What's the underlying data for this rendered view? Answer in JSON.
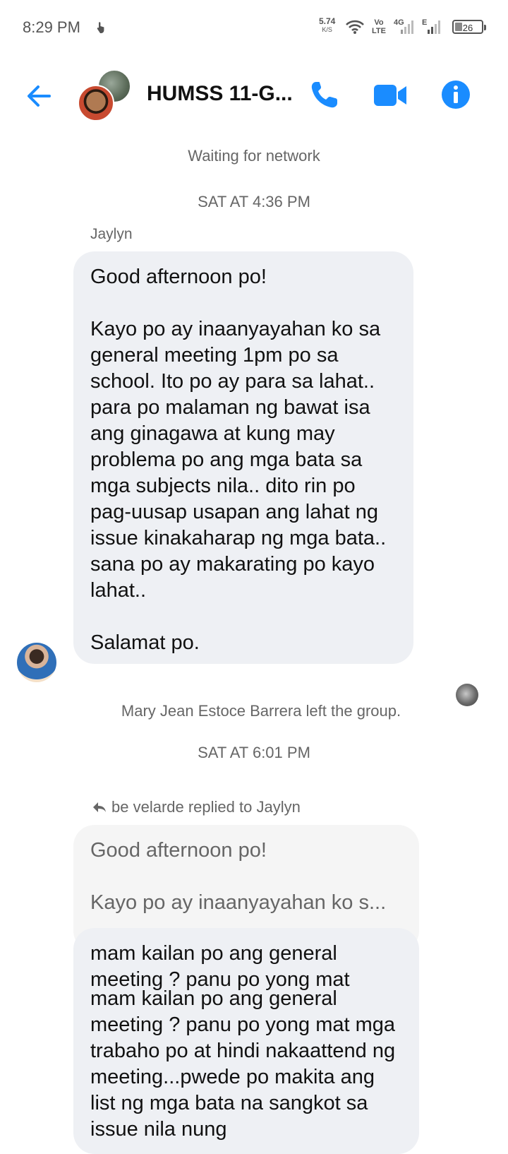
{
  "status_bar": {
    "time": "8:29 PM",
    "net_speed": "5.74",
    "net_unit": "K/S",
    "volte_top": "Vo",
    "volte_bottom": "LTE",
    "net_type": "4G",
    "net_type2": "E",
    "battery": "26"
  },
  "header": {
    "title": "HUMSS 11-G...",
    "accent_color": "#1a8cff",
    "icons": [
      "back-arrow-icon",
      "phone-icon",
      "video-call-icon",
      "info-icon"
    ]
  },
  "conversation": {
    "network_status": "Waiting for network",
    "timestamp_1": "SAT AT 4:36 PM",
    "message_1": {
      "sender": "Jaylyn",
      "text": "Good afternoon po!\n\nKayo po ay inaanyayahan ko sa general meeting 1pm po sa school. Ito po ay para sa lahat.. para po malaman ng bawat isa ang ginagawa at kung may problema po ang mga bata sa mga subjects nila.. dito rin po pag-uusap usapan ang lahat ng issue kinakaharap ng mga bata.. sana po ay makarating po kayo lahat..\n\nSalamat po."
    },
    "system_notice": "Mary Jean Estoce Barrera left the group.",
    "timestamp_2": "SAT AT 6:01 PM",
    "reply": {
      "label": "be velarde replied to Jaylyn",
      "quoted_line1": "Good afternoon po!",
      "quoted_line2": "Kayo po ay inaanyayahan ko s...",
      "text_top": "mam kailan po ang general meeting ? panu po yong mat",
      "text": "mam kailan po ang general meeting ? panu po yong mat mga trabaho po at hindi nakaattend ng meeting...pwede po makita ang list ng mga bata na sangkot sa issue nila nung"
    }
  }
}
